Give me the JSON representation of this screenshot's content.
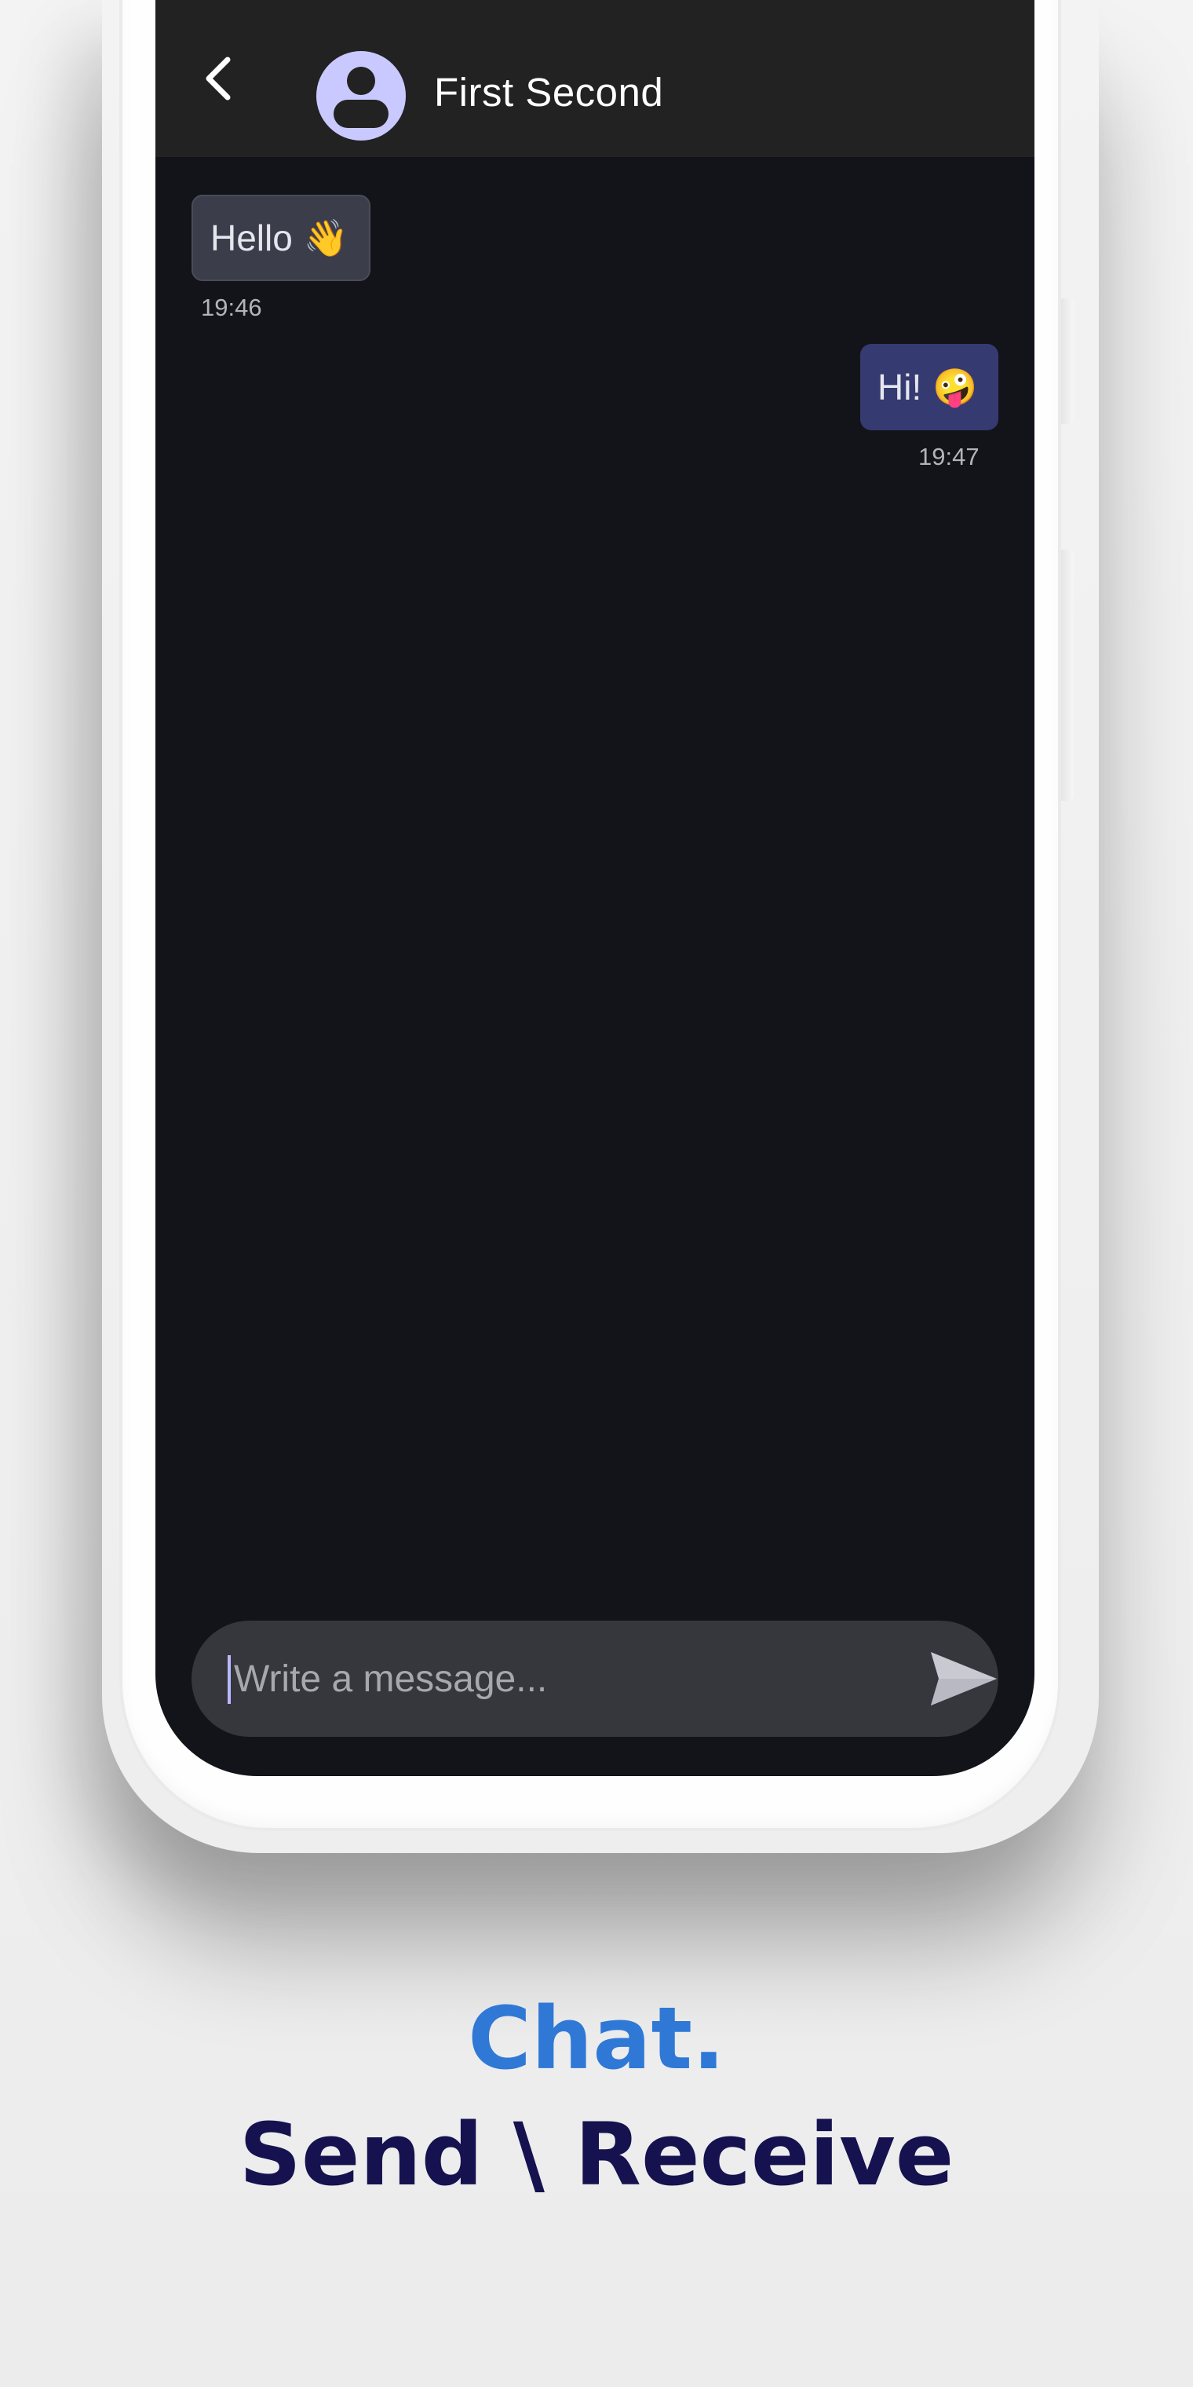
{
  "colors": {
    "app_bar": "#222222",
    "screen_bg": "#13141a",
    "incoming_bubble": "#3c3d4a",
    "outgoing_bubble": "#353a71",
    "avatar_bg": "#c9c9ff",
    "caption_primary": "#2f78d6",
    "caption_secondary": "#15124f"
  },
  "app_bar": {
    "back_icon": "chevron-left-icon",
    "avatar_icon": "user-avatar-icon",
    "contact_name": "First Second"
  },
  "messages": [
    {
      "direction": "incoming",
      "text": "Hello",
      "emoji": "👋",
      "time": "19:46"
    },
    {
      "direction": "outgoing",
      "text": "Hi!",
      "emoji": "🤪",
      "time": "19:47"
    }
  ],
  "composer": {
    "placeholder": "Write a message...",
    "value": "",
    "send_icon": "send-icon"
  },
  "caption": {
    "line1": "Chat.",
    "line2": "Send \\ Receive"
  }
}
